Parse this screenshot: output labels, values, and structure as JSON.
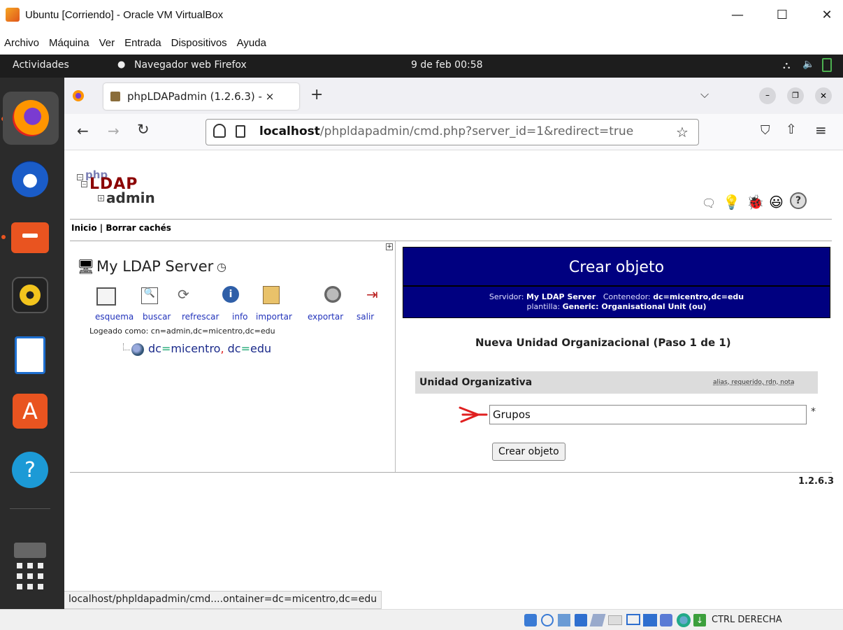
{
  "vbox": {
    "title": "Ubuntu [Corriendo] - Oracle VM VirtualBox",
    "menu": [
      "Archivo",
      "Máquina",
      "Ver",
      "Entrada",
      "Dispositivos",
      "Ayuda"
    ],
    "status_key": "CTRL DERECHA"
  },
  "ubuntu": {
    "activities": "Actividades",
    "app_name": "Navegador web Firefox",
    "clock": "9 de feb  00:58"
  },
  "firefox": {
    "tab_title": "phpLDAPadmin (1.2.6.3) - ×",
    "new_tab": "+",
    "url_host": "localhost",
    "url_path": "/phpldapadmin/cmd.php?server_id=1&redirect=true",
    "status_url": "localhost/phpldapadmin/cmd....ontainer=dc=micentro,dc=edu"
  },
  "pla": {
    "logo_php": "php",
    "logo_ldap": "LDAP",
    "logo_admin": "admin",
    "nav_home": "Inicio",
    "nav_sep": "|",
    "nav_purge": "Borrar cachés",
    "server_name": "My LDAP Server",
    "actions": [
      "esquema",
      "buscar",
      "refrescar",
      "info",
      "importar",
      "exportar",
      "salir"
    ],
    "logged_as": "Logeado como: cn=admin,dc=micentro,dc=edu",
    "tree_entry": {
      "a": "dc",
      "b": "=",
      "c": "micentro",
      "d": ",",
      "e": " dc",
      "f": "=",
      "g": "edu"
    },
    "panel_title": "Crear objeto",
    "srv_label": "Servidor:",
    "srv_value": "My LDAP Server",
    "cont_label": "Contenedor:",
    "cont_value": "dc=micentro,dc=edu",
    "tpl_label": "plantilla:",
    "tpl_value": "Generic: Organisational Unit (ou)",
    "step_title": "Nueva Unidad Organizacional (Paso 1 de 1)",
    "attr_label": "Unidad Organizativa",
    "attr_hints": "alias, requerido, rdn, nota",
    "ou_value": "Grupos",
    "required_mark": "*",
    "submit_label": "Crear objeto",
    "version": "1.2.6.3"
  },
  "colors": {
    "panel_bg": "#000080",
    "link_blue": "#2233bb",
    "arrow_red": "#e02020"
  }
}
